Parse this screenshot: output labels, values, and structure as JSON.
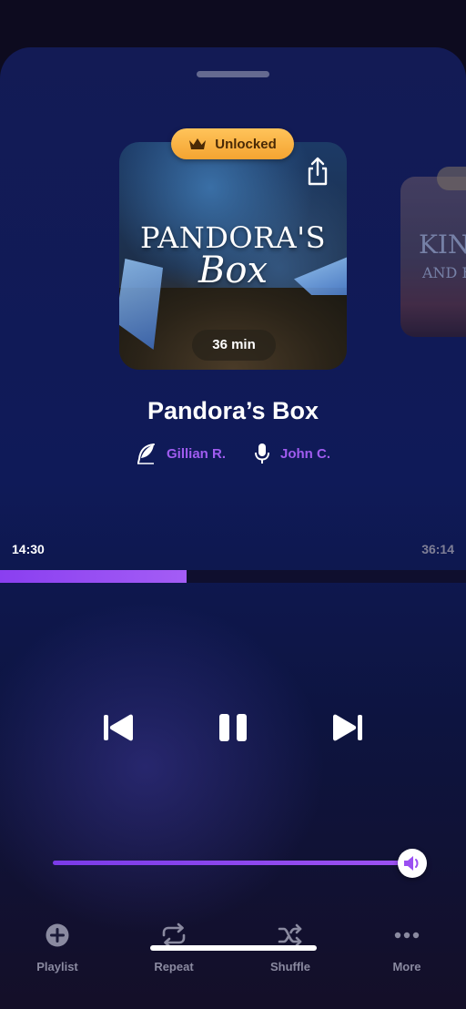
{
  "badge": {
    "label": "Unlocked",
    "icon": "crown-icon"
  },
  "cover": {
    "title_line1": "PANDORA'S",
    "title_line2": "Box",
    "duration": "36 min"
  },
  "next_cover": {
    "line1": "KING",
    "line2": "AND H"
  },
  "track": {
    "title": "Pandora’s Box",
    "author": "Gillian R.",
    "narrator": "John C."
  },
  "playback": {
    "current_time": "14:30",
    "total_time": "36:14",
    "progress": 0.4,
    "volume": 1.0
  },
  "tabs": [
    {
      "label": "Playlist",
      "icon": "plus-circle-icon"
    },
    {
      "label": "Repeat",
      "icon": "repeat-icon"
    },
    {
      "label": "Shuffle",
      "icon": "shuffle-icon"
    },
    {
      "label": "More",
      "icon": "ellipsis-icon"
    }
  ],
  "colors": {
    "accent": "#9b4ff2",
    "badge": "#f6ad3a",
    "credit_text": "#a05cf0",
    "muted": "#8a8aa0"
  }
}
